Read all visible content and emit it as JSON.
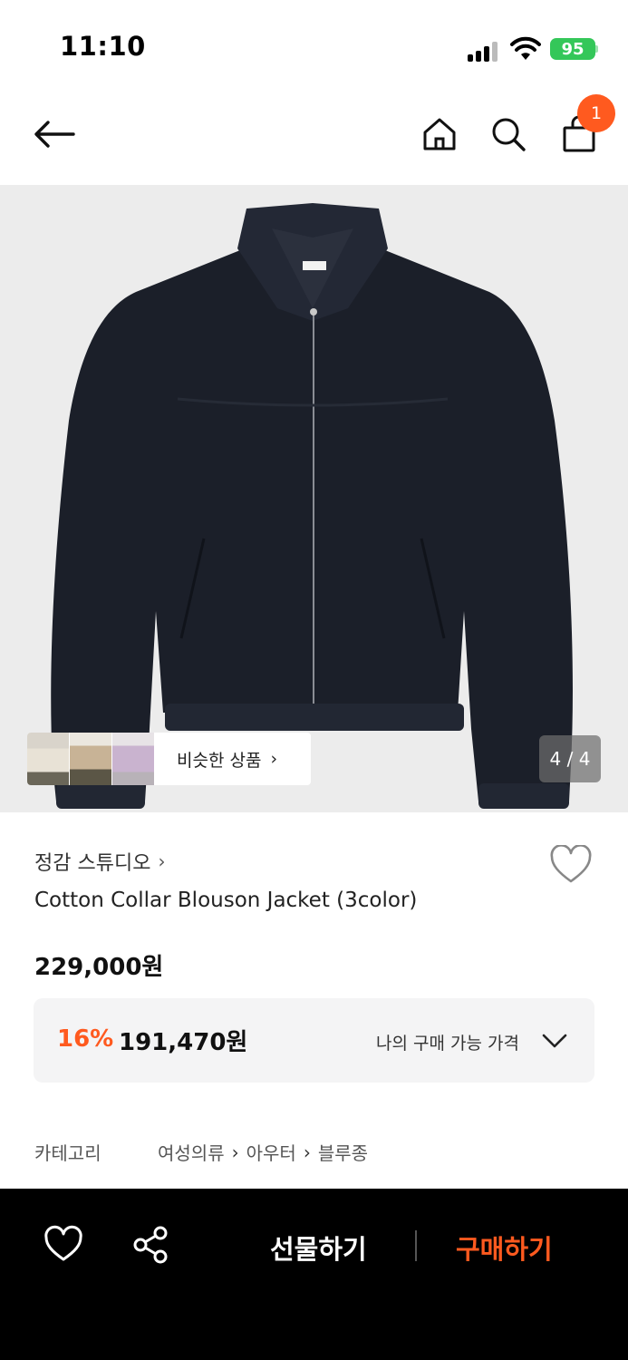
{
  "status_bar": {
    "time": "11:10",
    "battery": "95"
  },
  "nav": {
    "back_icon": "arrow-left-icon",
    "home_icon": "home-icon",
    "search_icon": "search-icon",
    "cart_icon": "shopping-bag-icon",
    "cart_count": "1"
  },
  "gallery": {
    "similar_label": "비슷한 상품",
    "similar_chevron": "›",
    "counter": "4 / 4",
    "current_image": 4,
    "total_images": 4
  },
  "product": {
    "brand": "정감 스튜디오",
    "brand_chevron": "›",
    "title": "Cotton Collar Blouson Jacket (3color)",
    "price": "229,000원",
    "discount_rate": "16%",
    "discount_price": "191,470원",
    "discount_label": "나의 구매 가능 가격"
  },
  "category": {
    "label": "카테고리",
    "path": [
      "여성의류",
      "아우터",
      "블루종"
    ]
  },
  "bottom_bar": {
    "gift_label": "선물하기",
    "buy_label": "구매하기"
  },
  "colors": {
    "accent": "#ff5a1f",
    "battery": "#34c759",
    "hero_bg": "#ececec",
    "jacket": "#1b1f29"
  }
}
